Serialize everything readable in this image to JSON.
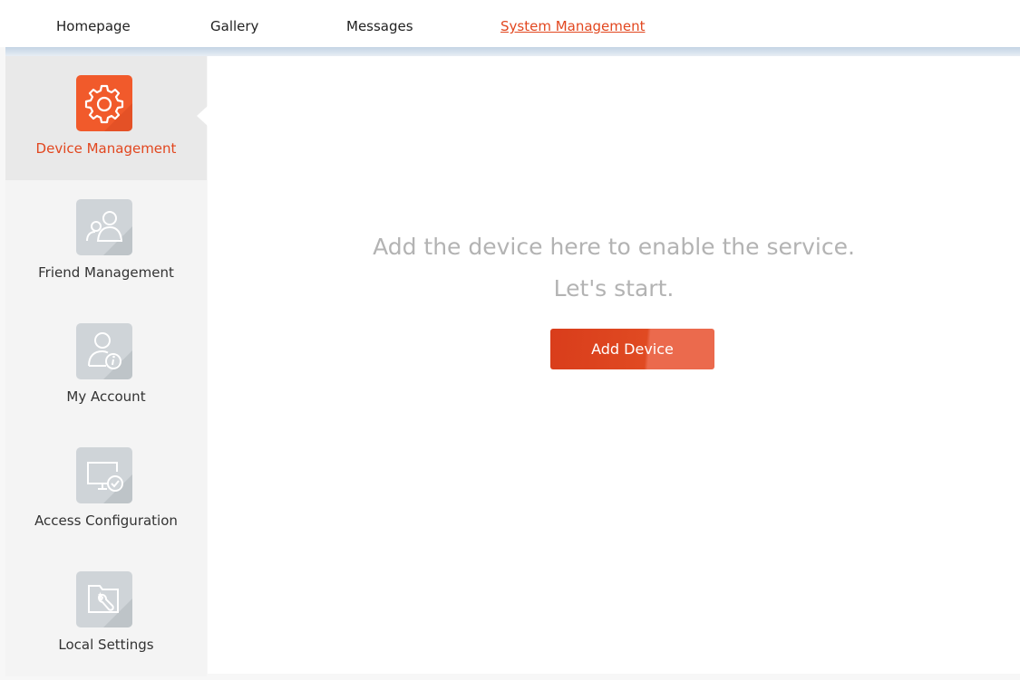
{
  "topnav": {
    "items": [
      {
        "label": "Homepage",
        "active": false
      },
      {
        "label": "Gallery",
        "active": false
      },
      {
        "label": "Messages",
        "active": false
      },
      {
        "label": "System Management",
        "active": true
      }
    ],
    "accent_color": "#e2471f"
  },
  "sidebar": {
    "items": [
      {
        "label": "Device Management",
        "icon": "gear-icon",
        "active": true
      },
      {
        "label": "Friend Management",
        "icon": "friends-icon",
        "active": false
      },
      {
        "label": "My Account",
        "icon": "user-info-icon",
        "active": false
      },
      {
        "label": "Access Configuration",
        "icon": "monitor-check-icon",
        "active": false
      },
      {
        "label": "Local Settings",
        "icon": "folder-wrench-icon",
        "active": false
      }
    ],
    "active_icon_color": "#f15a2b",
    "inactive_icon_color": "#cfd4d8"
  },
  "main": {
    "empty_message_line1": "Add the device here to enable the service.",
    "empty_message_line2": "Let's start.",
    "add_button_label": "Add Device"
  }
}
